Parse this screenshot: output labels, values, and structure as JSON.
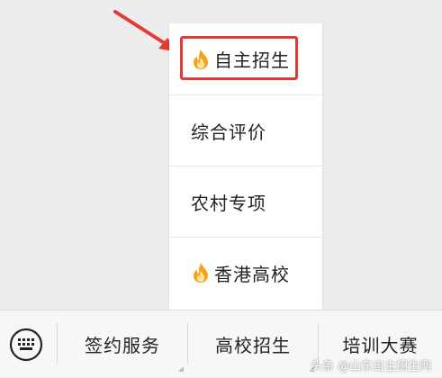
{
  "popup_menu": {
    "items": [
      {
        "label": "自主招生",
        "icon": "fire-icon",
        "highlighted": true
      },
      {
        "label": "综合评价"
      },
      {
        "label": "农村专项"
      },
      {
        "label": "香港高校",
        "icon": "fire-icon"
      }
    ]
  },
  "bottom_bar": {
    "keyboard_icon": "keyboard-icon",
    "tabs": [
      {
        "label": "签约服务"
      },
      {
        "label": "高校招生"
      },
      {
        "label": "培训大赛"
      }
    ]
  },
  "watermark": "头条 @山东自主招生网",
  "colors": {
    "background": "#ededed",
    "highlight": "#e53935",
    "arrow": "#e53935",
    "bar_background": "#f7f7f7"
  }
}
